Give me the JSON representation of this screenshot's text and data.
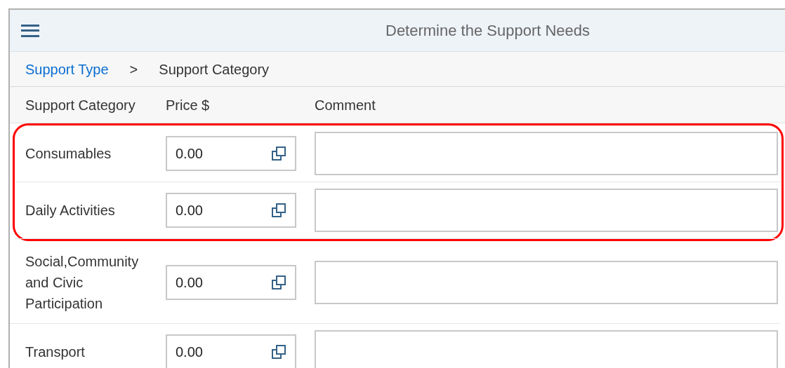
{
  "header": {
    "title": "Determine the Support Needs"
  },
  "breadcrumb": [
    {
      "label": "Support Type",
      "link": true
    },
    {
      "label": ">",
      "link": false
    },
    {
      "label": "Support Category",
      "link": false
    }
  ],
  "columns": [
    "Support Category",
    "Price $",
    "Comment"
  ],
  "rows": [
    {
      "category": "Consumables",
      "price": "0.00",
      "highlighted": true
    },
    {
      "category": "Daily Activities",
      "price": "0.00",
      "highlighted": true
    },
    {
      "category": "Social,Community and Civic Participation",
      "price": "0.00",
      "highlighted": false
    },
    {
      "category": "Transport",
      "price": "0.00",
      "highlighted": false
    }
  ]
}
